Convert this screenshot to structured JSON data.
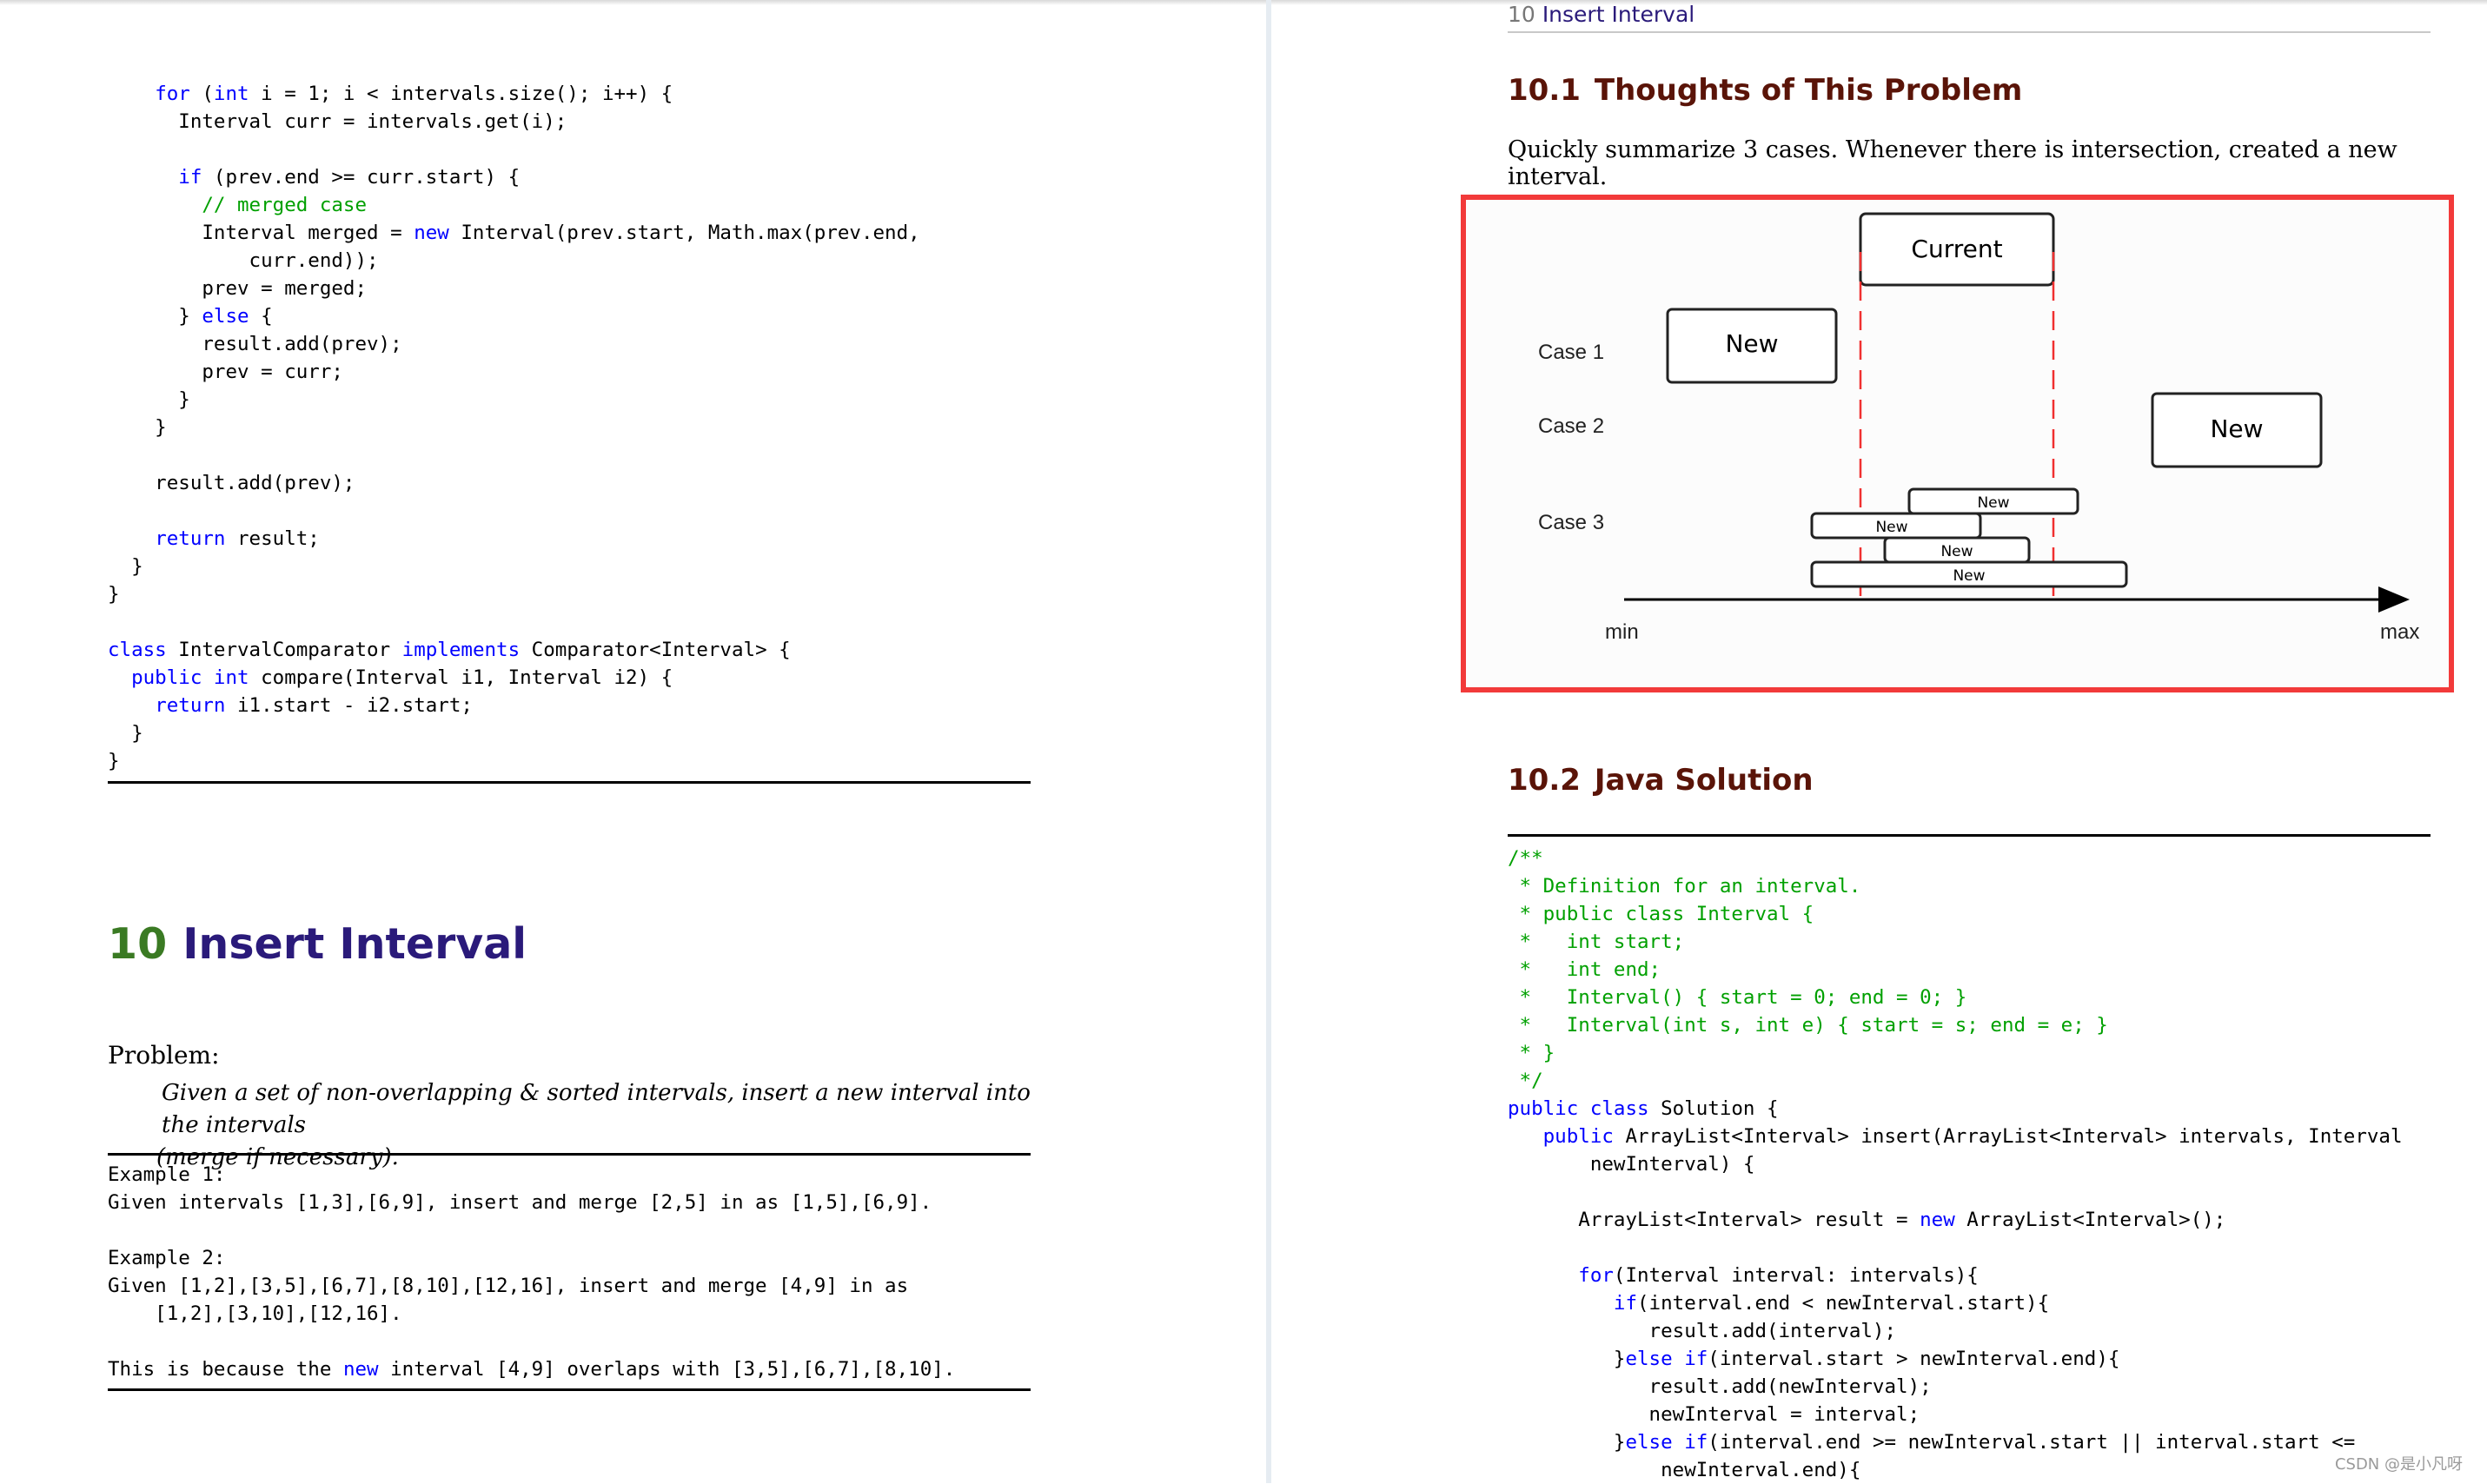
{
  "left_page": {
    "code_top": [
      [
        {
          "t": "    "
        },
        {
          "t": "for",
          "c": "kw"
        },
        {
          "t": " ("
        },
        {
          "t": "int",
          "c": "kw"
        },
        {
          "t": " i = 1; i < intervals.size(); i++) {"
        }
      ],
      [
        {
          "t": "      Interval curr = intervals.get(i);"
        }
      ],
      [
        {
          "t": ""
        }
      ],
      [
        {
          "t": "      "
        },
        {
          "t": "if",
          "c": "kw"
        },
        {
          "t": " (prev.end >= curr.start) {"
        }
      ],
      [
        {
          "t": "        "
        },
        {
          "t": "// merged case",
          "c": "cm"
        }
      ],
      [
        {
          "t": "        Interval merged = "
        },
        {
          "t": "new",
          "c": "kw"
        },
        {
          "t": " Interval(prev.start, Math.max(prev.end,"
        }
      ],
      [
        {
          "t": "            curr.end));"
        }
      ],
      [
        {
          "t": "        prev = merged;"
        }
      ],
      [
        {
          "t": "      } "
        },
        {
          "t": "else",
          "c": "kw"
        },
        {
          "t": " {"
        }
      ],
      [
        {
          "t": "        result.add(prev);"
        }
      ],
      [
        {
          "t": "        prev = curr;"
        }
      ],
      [
        {
          "t": "      }"
        }
      ],
      [
        {
          "t": "    }"
        }
      ],
      [
        {
          "t": ""
        }
      ],
      [
        {
          "t": "    result.add(prev);"
        }
      ],
      [
        {
          "t": ""
        }
      ],
      [
        {
          "t": "    "
        },
        {
          "t": "return",
          "c": "kw"
        },
        {
          "t": " result;"
        }
      ],
      [
        {
          "t": "  }"
        }
      ],
      [
        {
          "t": "}"
        }
      ],
      [
        {
          "t": ""
        }
      ],
      [
        {
          "t": "class",
          "c": "kw"
        },
        {
          "t": " IntervalComparator "
        },
        {
          "t": "implements",
          "c": "kw"
        },
        {
          "t": " Comparator<Interval> {"
        }
      ],
      [
        {
          "t": "  "
        },
        {
          "t": "public",
          "c": "kw"
        },
        {
          "t": " "
        },
        {
          "t": "int",
          "c": "kw"
        },
        {
          "t": " compare(Interval i1, Interval i2) {"
        }
      ],
      [
        {
          "t": "    "
        },
        {
          "t": "return",
          "c": "kw"
        },
        {
          "t": " i1.start - i2.start;"
        }
      ],
      [
        {
          "t": "  }"
        }
      ],
      [
        {
          "t": "}"
        }
      ]
    ],
    "chapter": {
      "number": "10",
      "title": "Insert Interval"
    },
    "problem_label": "Problem:",
    "problem_text_line1": "Given a set of non-overlapping & sorted intervals, insert a new interval into the intervals",
    "problem_text_line2": "(merge if necessary).",
    "examples": [
      [
        {
          "t": "Example 1:"
        }
      ],
      [
        {
          "t": "Given intervals [1,3],[6,9], insert and merge [2,5] in as [1,5],[6,9]."
        }
      ],
      [
        {
          "t": ""
        }
      ],
      [
        {
          "t": "Example 2:"
        }
      ],
      [
        {
          "t": "Given [1,2],[3,5],[6,7],[8,10],[12,16], insert and merge [4,9] in as"
        }
      ],
      [
        {
          "t": "    [1,2],[3,10],[12,16]."
        }
      ],
      [
        {
          "t": ""
        }
      ],
      [
        {
          "t": "This is because the "
        },
        {
          "t": "new",
          "c": "kw"
        },
        {
          "t": " interval [4,9] overlaps with [3,5],[6,7],[8,10]."
        }
      ]
    ]
  },
  "right_page": {
    "running_head": {
      "number": "10",
      "title": "Insert Interval"
    },
    "section1": {
      "number": "10.1",
      "title": "Thoughts of This Problem"
    },
    "summary": "Quickly summarize 3 cases. Whenever there is intersection, created a new interval.",
    "figure": {
      "current_label": "Current",
      "case_labels": [
        "Case 1",
        "Case 2",
        "Case 3"
      ],
      "new_label": "New",
      "axis_min": "min",
      "axis_max": "max",
      "highlight_color": "#f23a3a"
    },
    "section2": {
      "number": "10.2",
      "title": "Java Solution"
    },
    "code": [
      [
        {
          "t": "/**",
          "c": "cm"
        }
      ],
      [
        {
          "t": " * Definition for an interval.",
          "c": "cm"
        }
      ],
      [
        {
          "t": " * public class Interval {",
          "c": "cm"
        }
      ],
      [
        {
          "t": " *   int start;",
          "c": "cm"
        }
      ],
      [
        {
          "t": " *   int end;",
          "c": "cm"
        }
      ],
      [
        {
          "t": " *   Interval() { start = 0; end = 0; }",
          "c": "cm"
        }
      ],
      [
        {
          "t": " *   Interval(int s, int e) { start = s; end = e; }",
          "c": "cm"
        }
      ],
      [
        {
          "t": " * }",
          "c": "cm"
        }
      ],
      [
        {
          "t": " */",
          "c": "cm"
        }
      ],
      [
        {
          "t": "public",
          "c": "kw"
        },
        {
          "t": " "
        },
        {
          "t": "class",
          "c": "kw"
        },
        {
          "t": " Solution {"
        }
      ],
      [
        {
          "t": "   "
        },
        {
          "t": "public",
          "c": "kw"
        },
        {
          "t": " ArrayList<Interval> insert(ArrayList<Interval> intervals, Interval"
        }
      ],
      [
        {
          "t": "       newInterval) {"
        }
      ],
      [
        {
          "t": ""
        }
      ],
      [
        {
          "t": "      ArrayList<Interval> result = "
        },
        {
          "t": "new",
          "c": "kw"
        },
        {
          "t": " ArrayList<Interval>();"
        }
      ],
      [
        {
          "t": ""
        }
      ],
      [
        {
          "t": "      "
        },
        {
          "t": "for",
          "c": "kw"
        },
        {
          "t": "(Interval interval: intervals){"
        }
      ],
      [
        {
          "t": "         "
        },
        {
          "t": "if",
          "c": "kw"
        },
        {
          "t": "(interval.end < newInterval.start){"
        }
      ],
      [
        {
          "t": "            result.add(interval);"
        }
      ],
      [
        {
          "t": "         }"
        },
        {
          "t": "else",
          "c": "kw"
        },
        {
          "t": " "
        },
        {
          "t": "if",
          "c": "kw"
        },
        {
          "t": "(interval.start > newInterval.end){"
        }
      ],
      [
        {
          "t": "            result.add(newInterval);"
        }
      ],
      [
        {
          "t": "            newInterval = interval;"
        }
      ],
      [
        {
          "t": "         }"
        },
        {
          "t": "else",
          "c": "kw"
        },
        {
          "t": " "
        },
        {
          "t": "if",
          "c": "kw"
        },
        {
          "t": "(interval.end >= newInterval.start || interval.start <="
        }
      ],
      [
        {
          "t": "             newInterval.end){"
        }
      ]
    ]
  },
  "watermark": "CSDN @是小凡呀"
}
